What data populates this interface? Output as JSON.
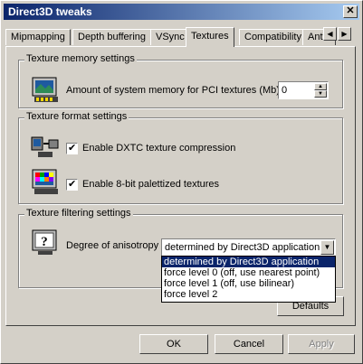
{
  "window": {
    "title": "Direct3D tweaks"
  },
  "tabs": [
    "Mipmapping",
    "Depth buffering",
    "VSync",
    "Textures",
    "Compatibility",
    "Antia"
  ],
  "groups": {
    "memory": {
      "title": "Texture memory settings",
      "label": "Amount of system memory for PCI textures (Mb)",
      "value": "0"
    },
    "format": {
      "title": "Texture format settings",
      "dxtc": "Enable DXTC texture compression",
      "palettized": "Enable 8-bit palettized textures"
    },
    "filtering": {
      "title": "Texture filtering settings",
      "label": "Degree of anisotropy",
      "selected": "determined by Direct3D application",
      "options": [
        "determined by Direct3D application",
        "force level 0 (off, use nearest point)",
        "force level 1 (off, use bilinear)",
        "force level 2"
      ]
    }
  },
  "buttons": {
    "defaults": "Defaults",
    "ok": "OK",
    "cancel": "Cancel",
    "apply": "Apply"
  }
}
